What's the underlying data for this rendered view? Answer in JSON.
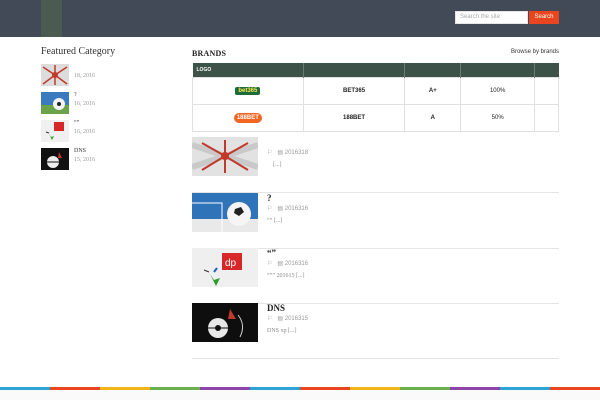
{
  "header": {
    "search_placeholder": "Search the site",
    "search_button": "Search"
  },
  "sidebar": {
    "title": "Featured Category",
    "items": [
      {
        "title": "",
        "date": "18, 2016"
      },
      {
        "title": "?",
        "date": "16, 2016"
      },
      {
        "title": "“”",
        "date": "16, 2016"
      },
      {
        "title": "DNS",
        "date": "15, 2016"
      }
    ]
  },
  "brands": {
    "title": "BRANDS",
    "browse": "Browse by brands",
    "column_header": "LOGO",
    "rows": [
      {
        "logo_text": "bet365",
        "name": "BET365",
        "grade": "A+",
        "percent": "100%"
      },
      {
        "logo_text": "188BET",
        "name": "188BET",
        "grade": "A",
        "percent": "50%"
      }
    ]
  },
  "posts": [
    {
      "title": "",
      "date": "2016318",
      "excerpt": "[...]"
    },
    {
      "title": "?",
      "date": "2016316",
      "excerpt": "“” [...]"
    },
    {
      "title": "“”",
      "date": "2016316",
      "excerpt": "“”” 201615 [...]"
    },
    {
      "title": "DNS",
      "date": "2016315",
      "excerpt": "DNS xp [...]"
    }
  ],
  "colors": {
    "topbar": "#414a56",
    "search_button": "#e9461f",
    "table_header": "#3d5248"
  }
}
